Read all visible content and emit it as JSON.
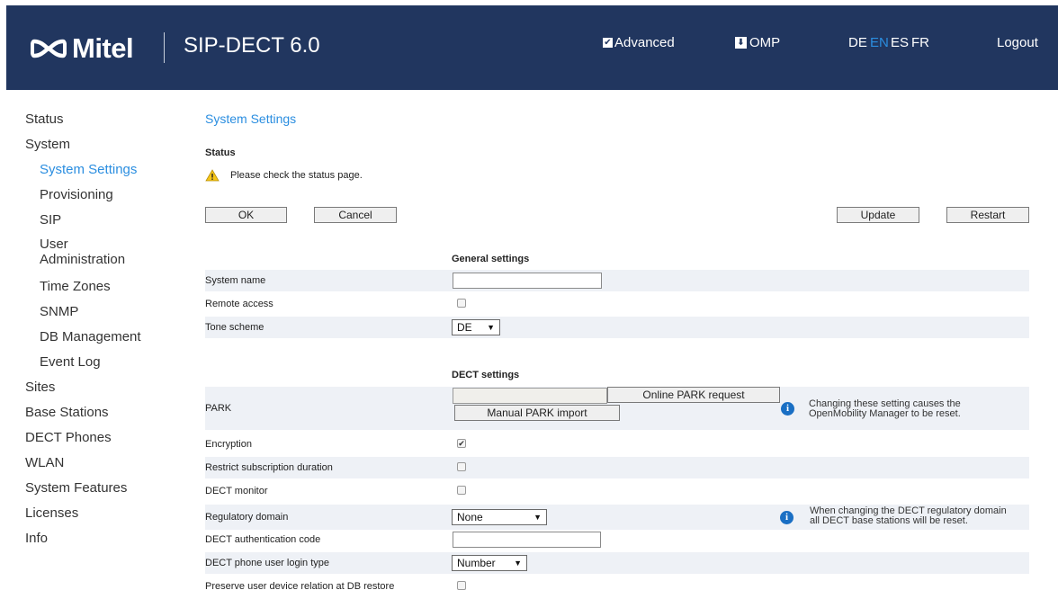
{
  "header": {
    "brand": "Mitel",
    "product": "SIP-DECT 6.0",
    "advanced_label": "Advanced",
    "advanced_checked": true,
    "omp_label": "OMP",
    "languages": [
      "DE",
      "EN",
      "ES",
      "FR"
    ],
    "active_language": "EN",
    "logout_label": "Logout",
    "colors": {
      "background": "#21365f",
      "accent": "#2b8ee0"
    }
  },
  "sidebar": {
    "items": [
      {
        "label": "Status",
        "level": 0
      },
      {
        "label": "System",
        "level": 0
      },
      {
        "label": "System Settings",
        "level": 1,
        "active": true
      },
      {
        "label": "Provisioning",
        "level": 1
      },
      {
        "label": "SIP",
        "level": 1
      },
      {
        "label": "User",
        "level": 1
      },
      {
        "label": "Administration",
        "level": 1
      },
      {
        "label": "Time Zones",
        "level": 1
      },
      {
        "label": "SNMP",
        "level": 1
      },
      {
        "label": "DB Management",
        "level": 1
      },
      {
        "label": "Event Log",
        "level": 1
      },
      {
        "label": "Sites",
        "level": 0
      },
      {
        "label": "Base Stations",
        "level": 0
      },
      {
        "label": "DECT Phones",
        "level": 0
      },
      {
        "label": "WLAN",
        "level": 0
      },
      {
        "label": "System Features",
        "level": 0
      },
      {
        "label": "Licenses",
        "level": 0
      },
      {
        "label": "Info",
        "level": 0
      }
    ]
  },
  "main": {
    "title": "System Settings",
    "status_heading": "Status",
    "status_message": "Please check the status page.",
    "buttons": {
      "ok": "OK",
      "cancel": "Cancel",
      "update": "Update",
      "restart": "Restart"
    },
    "general": {
      "heading": "General settings",
      "system_name_label": "System name",
      "system_name_value": "",
      "remote_access_label": "Remote access",
      "remote_access_checked": false,
      "tone_scheme_label": "Tone scheme",
      "tone_scheme_value": "DE"
    },
    "dect": {
      "heading": "DECT settings",
      "park_label": "PARK",
      "park_value": "",
      "online_park_button": "Online PARK request",
      "manual_park_button": "Manual PARK import",
      "park_note_1": "Changing these setting causes the",
      "park_note_2": "OpenMobility Manager to be reset.",
      "encryption_label": "Encryption",
      "encryption_checked": true,
      "restrict_label": "Restrict subscription duration",
      "restrict_checked": false,
      "monitor_label": "DECT monitor",
      "monitor_checked": false,
      "regulatory_label": "Regulatory domain",
      "regulatory_value": "None",
      "regulatory_note_1": "When changing the DECT regulatory domain",
      "regulatory_note_2": "all DECT base stations will be reset.",
      "auth_code_label": "DECT authentication code",
      "auth_code_value": "",
      "login_type_label": "DECT phone user login type",
      "login_type_value": "Number",
      "preserve_label": "Preserve user device relation at DB restore",
      "preserve_checked": false
    }
  }
}
